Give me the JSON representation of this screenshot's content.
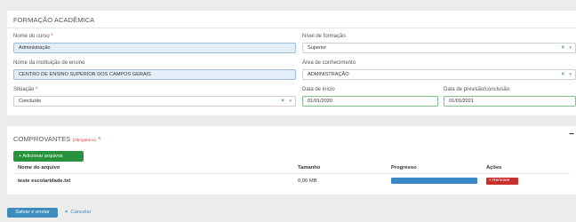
{
  "formacao": {
    "title": "FORMAÇÃO ACADÊMICA",
    "nome_curso": {
      "label": "Nome do curso",
      "required": "*",
      "value": "Administração"
    },
    "nivel": {
      "label": "Nível de formação",
      "value": "Superior"
    },
    "instituicao": {
      "label": "Nome da instituição de ensino",
      "value": "CENTRO DE ENSINO SUPERIOR DOS CAMPOS GERAIS"
    },
    "area": {
      "label": "Área de conhecimento",
      "value": "ADMINISTRAÇÃO"
    },
    "situacao": {
      "label": "Situação",
      "required": "*",
      "value": "Concluído"
    },
    "data_inicio": {
      "label": "Data de início",
      "value": "01/01/2020"
    },
    "data_conclusao": {
      "label": "Data de previsão/conclusão",
      "value": "01/01/2021"
    },
    "select_clear": "×",
    "select_arrow": "▼"
  },
  "comprovantes": {
    "title": "COMPROVANTES",
    "obrigatorio": "(Obrigatório)",
    "required": "*",
    "collapse": "−",
    "add_button": "+ Adicionar arquivos",
    "columns": [
      "Nome do arquivo",
      "Tamanho",
      "Progresso",
      "Ações"
    ],
    "file": {
      "name": "teste escolaridade.txt",
      "size": "0,00 MB",
      "progress": 1.0,
      "action": "× Remover"
    }
  },
  "footer": {
    "save": "Salvar e enviar",
    "cancel_icon": "×",
    "cancel": "Cancelar"
  },
  "colors": {
    "primary": "#3c8dbc",
    "success": "#27923b",
    "danger": "#c9302c",
    "progress": "#3a87c8"
  }
}
